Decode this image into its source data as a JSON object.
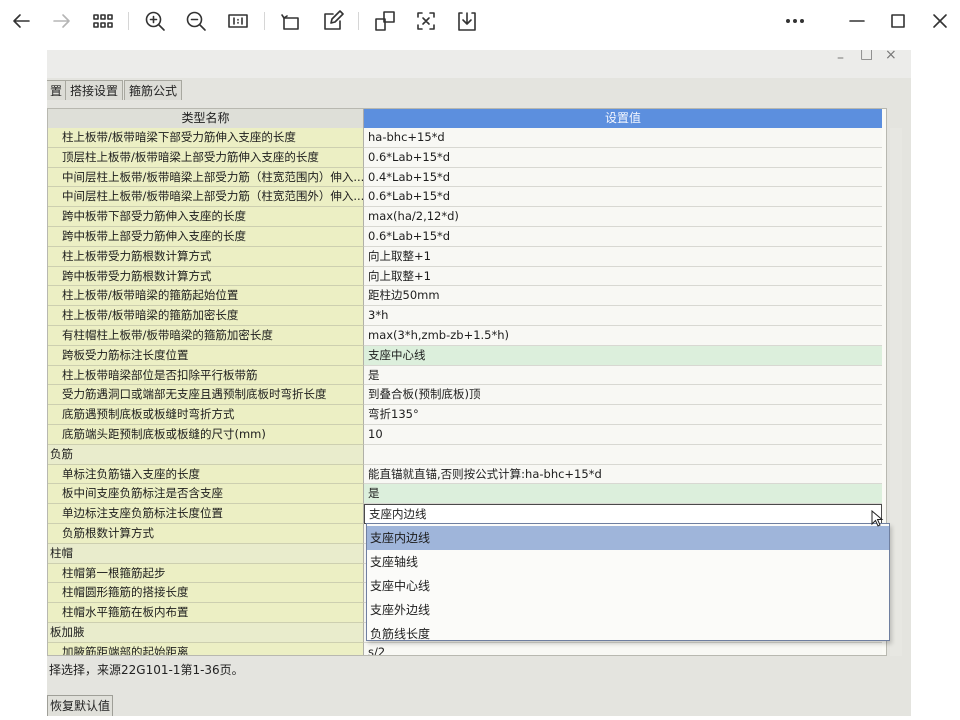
{
  "viewer": {
    "toolbar": [
      "back",
      "forward",
      "thumbnails",
      "zoom-in",
      "zoom-out",
      "actual-size",
      "rotate",
      "edit",
      "crop",
      "extract-text",
      "save",
      "more",
      "minimize",
      "maximize",
      "close"
    ]
  },
  "app": {
    "window_controls": [
      "–",
      "□",
      "×"
    ],
    "tabs": [
      "置",
      "搭接设置",
      "箍筋公式"
    ],
    "grid": {
      "col_name": "类型名称",
      "col_value": "设置值",
      "rows": [
        {
          "name": "柱上板带/板带暗梁下部受力筋伸入支座的长度",
          "value": "ha-bhc+15*d"
        },
        {
          "name": "顶层柱上板带/板带暗梁上部受力筋伸入支座的长度",
          "value": "0.6*Lab+15*d"
        },
        {
          "name": "中间层柱上板带/板带暗梁上部受力筋（柱宽范围内）伸入...",
          "value": "0.4*Lab+15*d"
        },
        {
          "name": "中间层柱上板带/板带暗梁上部受力筋（柱宽范围外）伸入...",
          "value": "0.6*Lab+15*d"
        },
        {
          "name": "跨中板带下部受力筋伸入支座的长度",
          "value": "max(ha/2,12*d)"
        },
        {
          "name": "跨中板带上部受力筋伸入支座的长度",
          "value": "0.6*Lab+15*d"
        },
        {
          "name": "柱上板带受力筋根数计算方式",
          "value": "向上取整+1"
        },
        {
          "name": "跨中板带受力筋根数计算方式",
          "value": "向上取整+1"
        },
        {
          "name": "柱上板带/板带暗梁的箍筋起始位置",
          "value": "距柱边50mm"
        },
        {
          "name": "柱上板带/板带暗梁的箍筋加密长度",
          "value": "3*h"
        },
        {
          "name": "有柱帽柱上板带/板带暗梁的箍筋加密长度",
          "value": "max(3*h,zmb-zb+1.5*h)"
        },
        {
          "name": "跨板受力筋标注长度位置",
          "value": "支座中心线",
          "green": true
        },
        {
          "name": "柱上板带暗梁部位是否扣除平行板带筋",
          "value": "是"
        },
        {
          "name": "受力筋遇洞口或端部无支座且遇预制底板时弯折长度",
          "value": "到叠合板(预制底板)顶"
        },
        {
          "name": "底筋遇预制底板或板缝时弯折方式",
          "value": "弯折135°"
        },
        {
          "name": "底筋端头距预制底板或板缝的尺寸(mm)",
          "value": "10"
        },
        {
          "name": "负筋",
          "value": "",
          "section": true
        },
        {
          "name": "单标注负筋锚入支座的长度",
          "value": "能直锚就直锚,否则按公式计算:ha-bhc+15*d"
        },
        {
          "name": "板中间支座负筋标注是否含支座",
          "value": "是",
          "green": true
        },
        {
          "name": "单边标注支座负筋标注长度位置",
          "value": "支座内边线",
          "active": true
        },
        {
          "name": "负筋根数计算方式",
          "value": ""
        },
        {
          "name": "柱帽",
          "value": "",
          "section": true
        },
        {
          "name": "柱帽第一根箍筋起步",
          "value": ""
        },
        {
          "name": "柱帽圆形箍筋的搭接长度",
          "value": ""
        },
        {
          "name": "柱帽水平箍筋在板内布置",
          "value": ""
        },
        {
          "name": "板加腋",
          "value": "",
          "section": true
        },
        {
          "name": "加腋筋距端部的起始距离",
          "value": "s/2"
        }
      ]
    },
    "dropdown": {
      "options": [
        "支座内边线",
        "支座轴线",
        "支座中心线",
        "支座外边线",
        "负筋线长度"
      ],
      "selected_index": 0
    },
    "status_text": "择选择，来源22G101-1第1-36页。",
    "restore_button": "恢复默认值"
  }
}
